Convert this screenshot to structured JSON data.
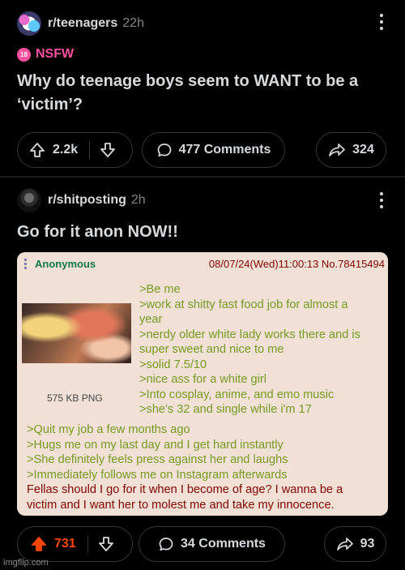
{
  "colors": {
    "background": "#000000",
    "nsfw": "#ff4fa0",
    "upvoted": "#ff4500",
    "greentext": "#789922",
    "quote_bg": "#f0e0d6"
  },
  "post1": {
    "avatar_icon": "teenagers-avatar",
    "subreddit": "r/teenagers",
    "age": "22h",
    "nsfw_badge": "18",
    "nsfw_label": "NSFW",
    "title": "Why do teenage boys seem to WANT to be a ‘victim’?",
    "score": "2.2k",
    "comments": "477 Comments",
    "shares": "324"
  },
  "post2": {
    "avatar_icon": "shitposting-avatar",
    "subreddit": "r/shitposting",
    "age": "2h",
    "title": "Go for it anon NOW!!",
    "screenshot": {
      "name": "Anonymous",
      "meta": "08/07/24(Wed)11:00:13 No.78415494",
      "file_info": "575 KB PNG",
      "greentext_right": [
        ">Be me",
        ">work at shitty fast food job for almost a",
        "year",
        ">nerdy older white lady works there and is",
        "super sweet and nice to me",
        ">solid 7.5/10",
        ">nice ass for a white girl",
        ">Into cosplay, anime, and emo music",
        ">she's 32 and single while i'm 17"
      ],
      "greentext_full": [
        ">Quit my job a few months ago",
        ">Hugs me on my last day and I get hard instantly",
        ">She definitely feels press against her and laughs",
        ">Immediately follows me on Instagram afterwards"
      ],
      "body": [
        "Fellas should I go for it when I become of age? I wanna be a",
        "victim and I want her to molest me and take my innocence."
      ]
    },
    "score": "731",
    "comments": "34 Comments",
    "shares": "93"
  },
  "watermark": "imgflip.com"
}
